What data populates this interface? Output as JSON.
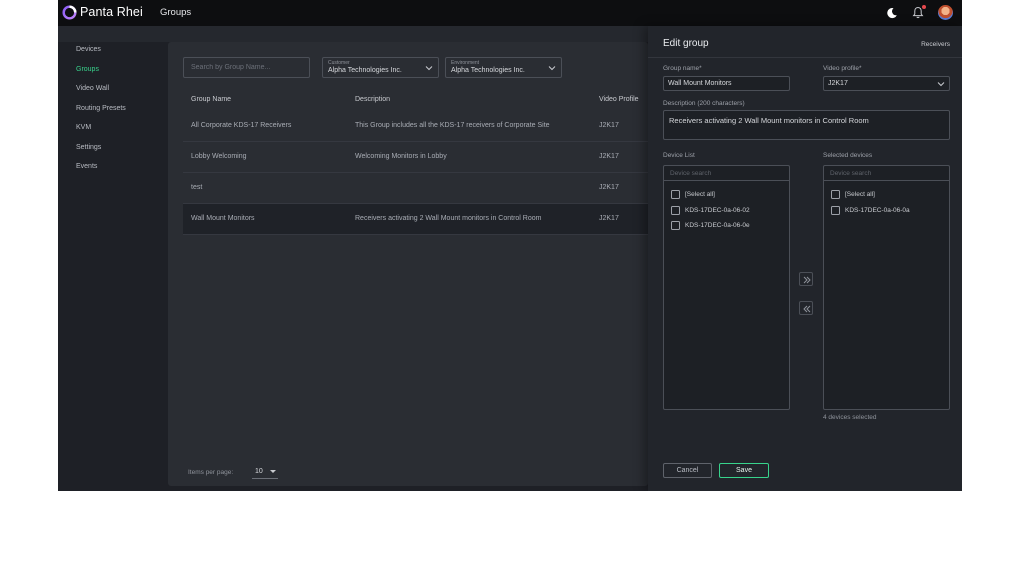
{
  "header": {
    "brand": "Panta Rhei",
    "section": "Groups",
    "icons": [
      "moon-icon",
      "bell-icon",
      "avatar"
    ]
  },
  "sidebar": {
    "items": [
      {
        "label": "Devices",
        "active": false
      },
      {
        "label": "Groups",
        "active": true
      },
      {
        "label": "Video Wall",
        "active": false
      },
      {
        "label": "Routing Presets",
        "active": false
      },
      {
        "label": "KVM",
        "active": false
      },
      {
        "label": "Settings",
        "active": false
      },
      {
        "label": "Events",
        "active": false
      }
    ]
  },
  "filters": {
    "search_placeholder": "Search by Group Name...",
    "customer": {
      "label": "Customer",
      "value": "Alpha Technologies Inc."
    },
    "environment": {
      "label": "Environment",
      "value": "Alpha Technologies Inc."
    }
  },
  "table": {
    "columns": [
      "Group Name",
      "Description",
      "Video Profile"
    ],
    "rows": [
      {
        "name": "All Corporate KDS-17 Receivers",
        "description": "This Group includes all the KDS-17 receivers of Corporate Site",
        "profile": "J2K17"
      },
      {
        "name": "Lobby Welcoming",
        "description": "Welcoming Monitors in Lobby",
        "profile": "J2K17"
      },
      {
        "name": "test",
        "description": "",
        "profile": "J2K17"
      },
      {
        "name": "Wall Mount Monitors",
        "description": "Receivers activating 2 Wall Mount monitors in Control Room",
        "profile": "J2K17"
      }
    ]
  },
  "pagination": {
    "label": "Items per page:",
    "value": "10"
  },
  "edit": {
    "title": "Edit group",
    "tab": "Receivers",
    "group_name_label": "Group name*",
    "group_name_value": "Wall Mount Monitors",
    "video_profile_label": "Video profile*",
    "video_profile_value": "J2K17",
    "description_label": "Description (200 characters)",
    "description_value": "Receivers activating 2 Wall Mount monitors in Control Room",
    "device_list_label": "Device List",
    "selected_label": "Selected devices",
    "device_search_placeholder": "Device search",
    "device_list": [
      "[Select all]",
      "KDS-17DEC-0a-06-02",
      "KDS-17DEC-0a-06-0e"
    ],
    "selected_list": [
      "[Select all]",
      "KDS-17DEC-0a-06-0a"
    ],
    "selected_count": "4 devices selected",
    "cancel_label": "Cancel",
    "save_label": "Save"
  },
  "colors": {
    "accent": "#38d38c",
    "background": "#1e2026",
    "panel": "#2a2d33",
    "topbar": "#0d0e10"
  }
}
